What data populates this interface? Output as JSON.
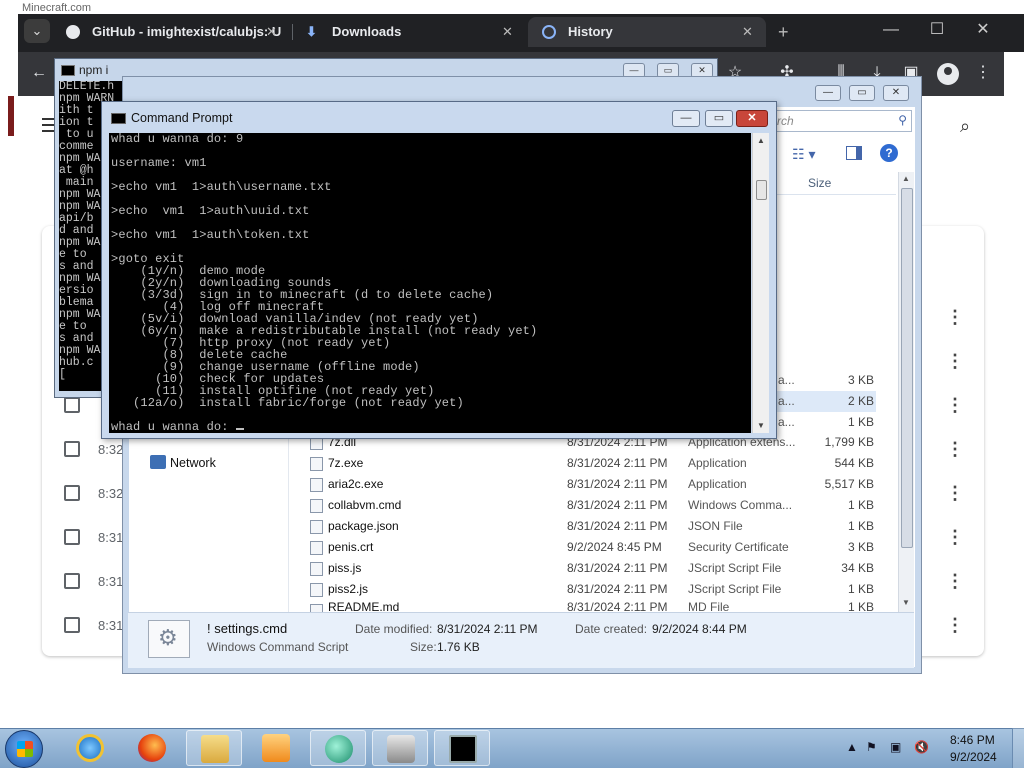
{
  "browser": {
    "window_title_faint": "Minecraft.com",
    "tabs": [
      {
        "label": "GitHub - imightexist/calubjs: U",
        "close": "✕"
      },
      {
        "label": "Downloads",
        "close": "✕"
      },
      {
        "label": "History",
        "close": "✕"
      }
    ],
    "new_tab": "+",
    "history_times": [
      "8:32",
      "8:32",
      "8:31",
      "8:31",
      "8:31"
    ]
  },
  "npm_window": {
    "title": "npm i",
    "lines": [
      "DELETE.h",
      "npm WARN",
      "ith t",
      "ion t",
      " to u",
      "comme",
      "npm WARN",
      "at @h",
      " main",
      "npm WARN",
      "npm WARN",
      "api/b",
      "d and",
      "npm WARN",
      "e to ",
      "s and",
      "npm WARN",
      "ersio",
      "blema",
      "npm WARN",
      "e to ",
      "s and",
      "npm WARN",
      "hub.c",
      "["
    ]
  },
  "cmd": {
    "title": "Command Prompt",
    "lines": [
      "whad u wanna do: 9",
      "",
      "username: vm1",
      "",
      ">echo vm1  1>auth\\username.txt",
      "",
      ">echo  vm1  1>auth\\uuid.txt",
      "",
      ">echo vm1  1>auth\\token.txt",
      "",
      ">goto exit",
      "    (1y/n)  demo mode",
      "    (2y/n)  downloading sounds",
      "    (3/3d)  sign in to minecraft (d to delete cache)",
      "       (4)  log off minecraft",
      "    (5v/i)  download vanilla/indev (not ready yet)",
      "    (6y/n)  make a redistributable install (not ready yet)",
      "       (7)  http proxy (not ready yet)",
      "       (8)  delete cache",
      "       (9)  change username (offline mode)",
      "      (10)  check for updates",
      "      (11)  install optifine (not ready yet)",
      "   (12a/o)  install fabric/forge (not ready yet)",
      "",
      "whad u wanna do: "
    ]
  },
  "explorer": {
    "search_placeholder": "rch",
    "col_size": "Size",
    "nav_network": "Network",
    "partial_rows": [
      {
        "type": "a...",
        "size": "3 KB"
      },
      {
        "type": "a...",
        "size": "2 KB"
      },
      {
        "type": "a...",
        "size": "1 KB"
      }
    ],
    "files": [
      {
        "name": "7z.dll",
        "date": "8/31/2024 2:11 PM",
        "type": "Application extens...",
        "size": "1,799 KB"
      },
      {
        "name": "7z.exe",
        "date": "8/31/2024 2:11 PM",
        "type": "Application",
        "size": "544 KB"
      },
      {
        "name": "aria2c.exe",
        "date": "8/31/2024 2:11 PM",
        "type": "Application",
        "size": "5,517 KB"
      },
      {
        "name": "collabvm.cmd",
        "date": "8/31/2024 2:11 PM",
        "type": "Windows Comma...",
        "size": "1 KB"
      },
      {
        "name": "package.json",
        "date": "8/31/2024 2:11 PM",
        "type": "JSON File",
        "size": "1 KB"
      },
      {
        "name": "penis.crt",
        "date": "9/2/2024 8:45 PM",
        "type": "Security Certificate",
        "size": "3 KB"
      },
      {
        "name": "piss.js",
        "date": "8/31/2024 2:11 PM",
        "type": "JScript Script File",
        "size": "34 KB"
      },
      {
        "name": "piss2.js",
        "date": "8/31/2024 2:11 PM",
        "type": "JScript Script File",
        "size": "1 KB"
      },
      {
        "name": "README.md",
        "date": "8/31/2024 2:11 PM",
        "type": "MD File",
        "size": "1 KB"
      }
    ],
    "details": {
      "name": "! settings.cmd",
      "type": "Windows Command Script",
      "modified_label": "Date modified:",
      "modified_value": "8/31/2024 2:11 PM",
      "size_label": "Size:",
      "size_value": "1.76 KB",
      "created_label": "Date created:",
      "created_value": "9/2/2024 8:44 PM"
    }
  },
  "taskbar": {
    "time": "8:46 PM",
    "date": "9/2/2024"
  }
}
